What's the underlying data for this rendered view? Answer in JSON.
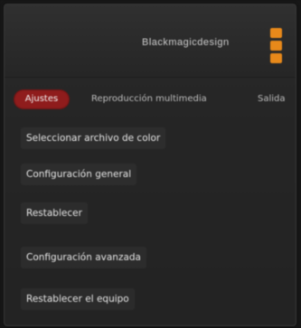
{
  "app": {
    "brand": "Blackmagicdesign"
  },
  "tabs": [
    {
      "label": "Ajustes",
      "active": true
    },
    {
      "label": "Reproducción multimedia",
      "active": false
    },
    {
      "label": "Salida",
      "active": false
    }
  ],
  "menu": {
    "items": [
      {
        "label": "Seleccionar archivo de color"
      },
      {
        "label": "Configuración general"
      },
      {
        "label": "Restablecer"
      },
      {
        "label": "Configuración avanzada"
      },
      {
        "label": "Restablecer el equipo"
      }
    ]
  },
  "colors": {
    "accent": "#8f1c1c",
    "logo": "#e8891a",
    "panel": "#262626"
  }
}
